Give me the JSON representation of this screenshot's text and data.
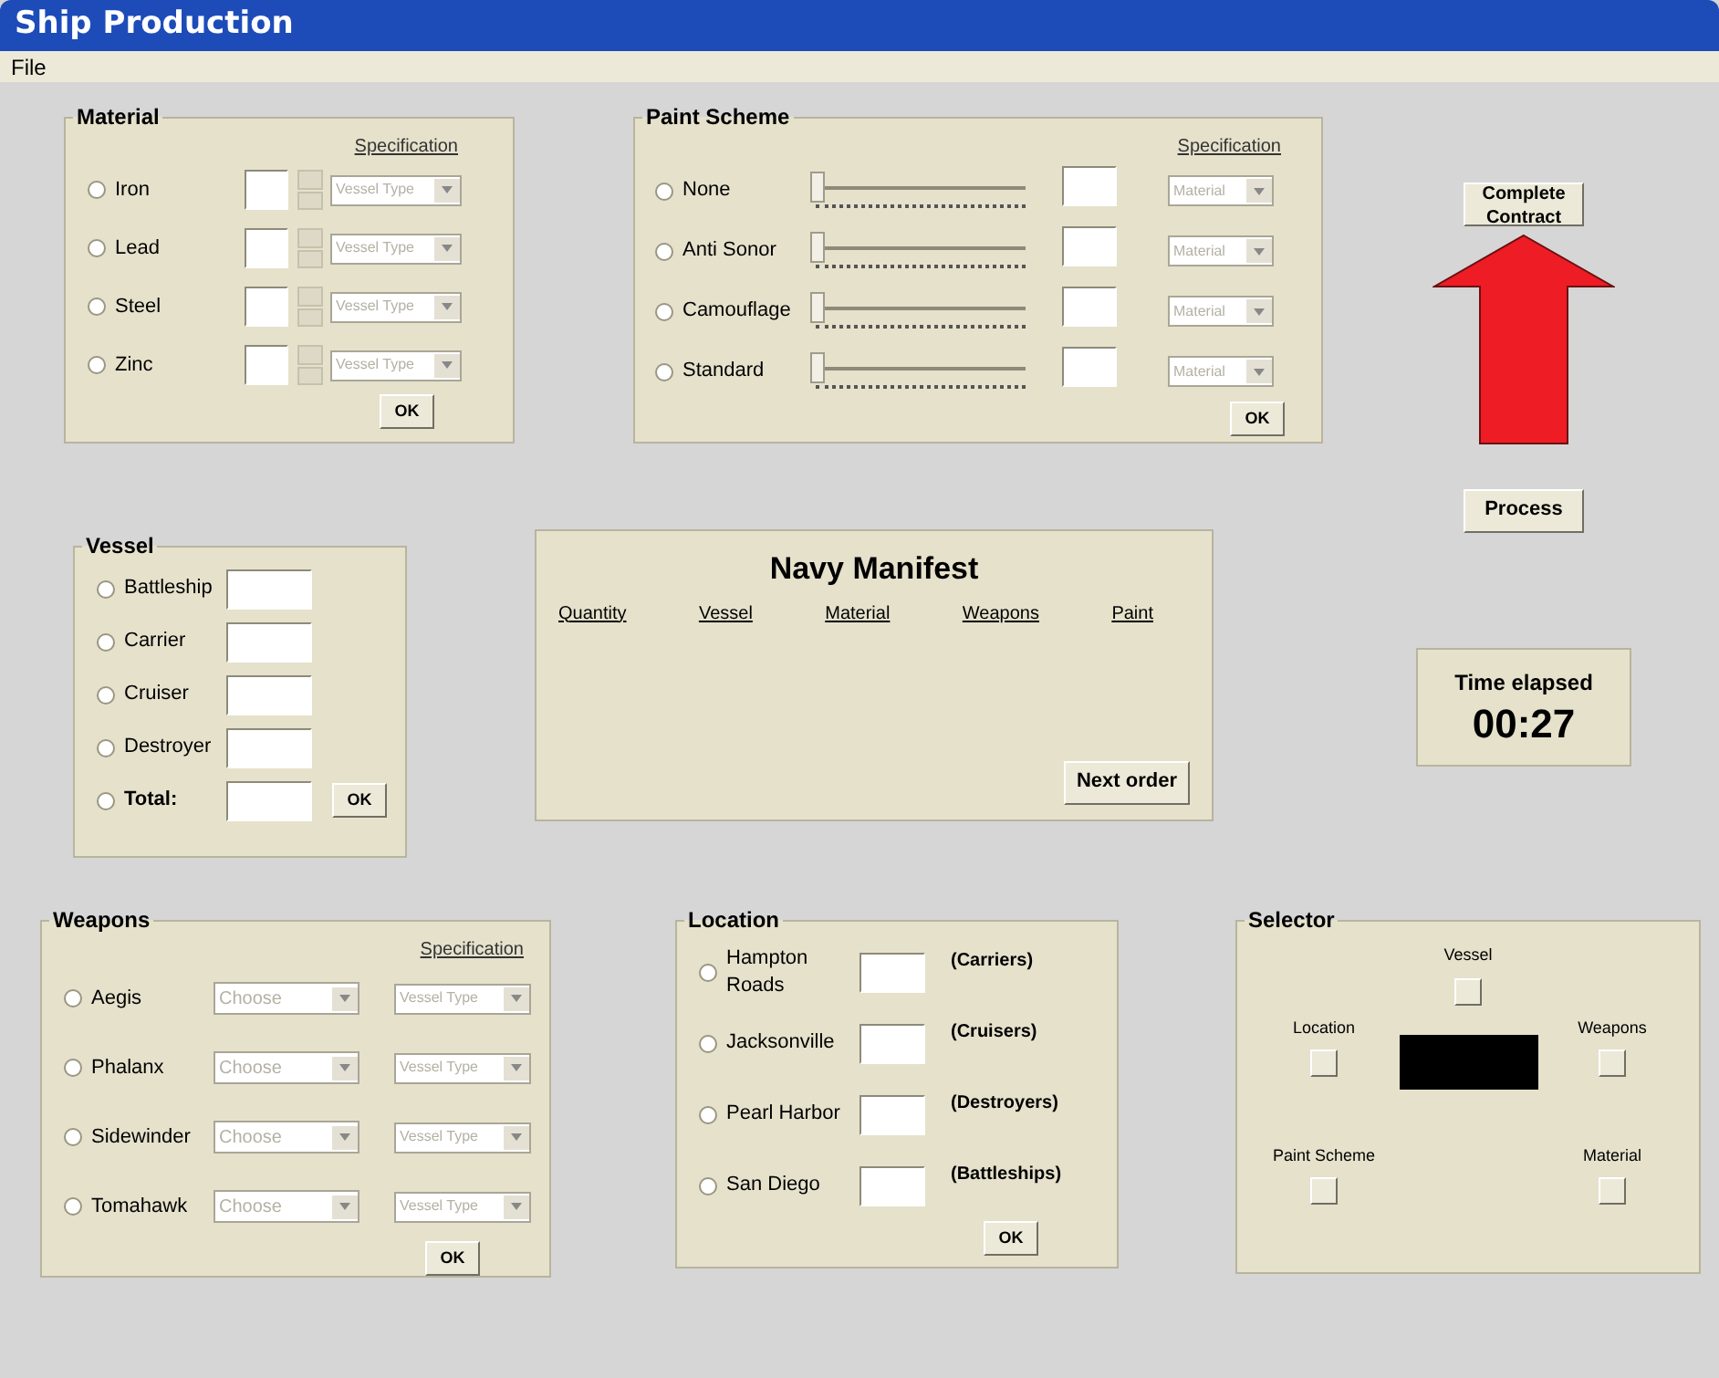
{
  "window": {
    "title": "Ship Production"
  },
  "menu": [
    "File"
  ],
  "material": {
    "title": "Material",
    "spec_header": "Specification",
    "items": [
      {
        "label": "Iron",
        "selected": false,
        "spec": "Vessel Type",
        "disabled": true
      },
      {
        "label": "Lead",
        "selected": false,
        "spec": "Vessel Type",
        "disabled": true
      },
      {
        "label": "Steel",
        "selected": false,
        "spec": "Vessel Type",
        "disabled": true
      },
      {
        "label": "Zinc",
        "selected": false,
        "spec": "Vessel Type",
        "disabled": true
      }
    ],
    "ok": "OK"
  },
  "paint": {
    "title": "Paint Scheme",
    "spec_header": "Specification",
    "items": [
      {
        "label": "None",
        "selected": false,
        "level": 0,
        "spec": "Material",
        "disabled": true
      },
      {
        "label": "Anti Sonor",
        "selected": false,
        "level": 0,
        "spec": "Material",
        "disabled": true
      },
      {
        "label": "Camouflage",
        "selected": false,
        "level": 0,
        "spec": "Material",
        "disabled": true
      },
      {
        "label": "Standard",
        "selected": false,
        "level": 0,
        "spec": "Material",
        "disabled": true
      }
    ],
    "ok": "OK"
  },
  "complete_button": "Complete Contract",
  "process_button": "Process",
  "vessel": {
    "title": "Vessel",
    "items": [
      {
        "label": "Battleship",
        "selected": false,
        "bold": false
      },
      {
        "label": "Carrier",
        "selected": false,
        "bold": false
      },
      {
        "label": "Cruiser",
        "selected": false,
        "bold": false
      },
      {
        "label": "Destroyer",
        "selected": false,
        "bold": false
      },
      {
        "label": "Total:",
        "selected": false,
        "bold": true
      }
    ],
    "ok": "OK"
  },
  "manifest": {
    "title": "Navy Manifest",
    "columns": [
      "Quantity",
      "Vessel",
      "Material",
      "Weapons",
      "Paint"
    ],
    "next_button": "Next order"
  },
  "timer": {
    "label": "Time elapsed",
    "value": "00:27"
  },
  "weapons": {
    "title": "Weapons",
    "spec_header": "Specification",
    "items": [
      {
        "label": "Aegis",
        "selected": false,
        "choice": "Choose",
        "spec": "Vessel Type",
        "disabled": true
      },
      {
        "label": "Phalanx",
        "selected": false,
        "choice": "Choose",
        "spec": "Vessel Type",
        "disabled": true
      },
      {
        "label": "Sidewinder",
        "selected": false,
        "choice": "Choose",
        "spec": "Vessel Type",
        "disabled": true
      },
      {
        "label": "Tomahawk",
        "selected": false,
        "choice": "Choose",
        "spec": "Vessel Type",
        "disabled": true
      }
    ],
    "ok": "OK"
  },
  "location": {
    "title": "Location",
    "items": [
      {
        "label": "Hampton Roads",
        "note": "(Carriers)",
        "selected": false
      },
      {
        "label": "Jacksonville",
        "note": "(Cruisers)",
        "selected": false
      },
      {
        "label": "Pearl Harbor",
        "note": "(Destroyers)",
        "selected": false
      },
      {
        "label": "San Diego",
        "note": "(Battleships)",
        "selected": false
      }
    ],
    "ok": "OK"
  },
  "selector": {
    "title": "Selector",
    "vessel": "Vessel",
    "location": "Location",
    "weapons": "Weapons",
    "paint": "Paint Scheme",
    "material": "Material"
  }
}
